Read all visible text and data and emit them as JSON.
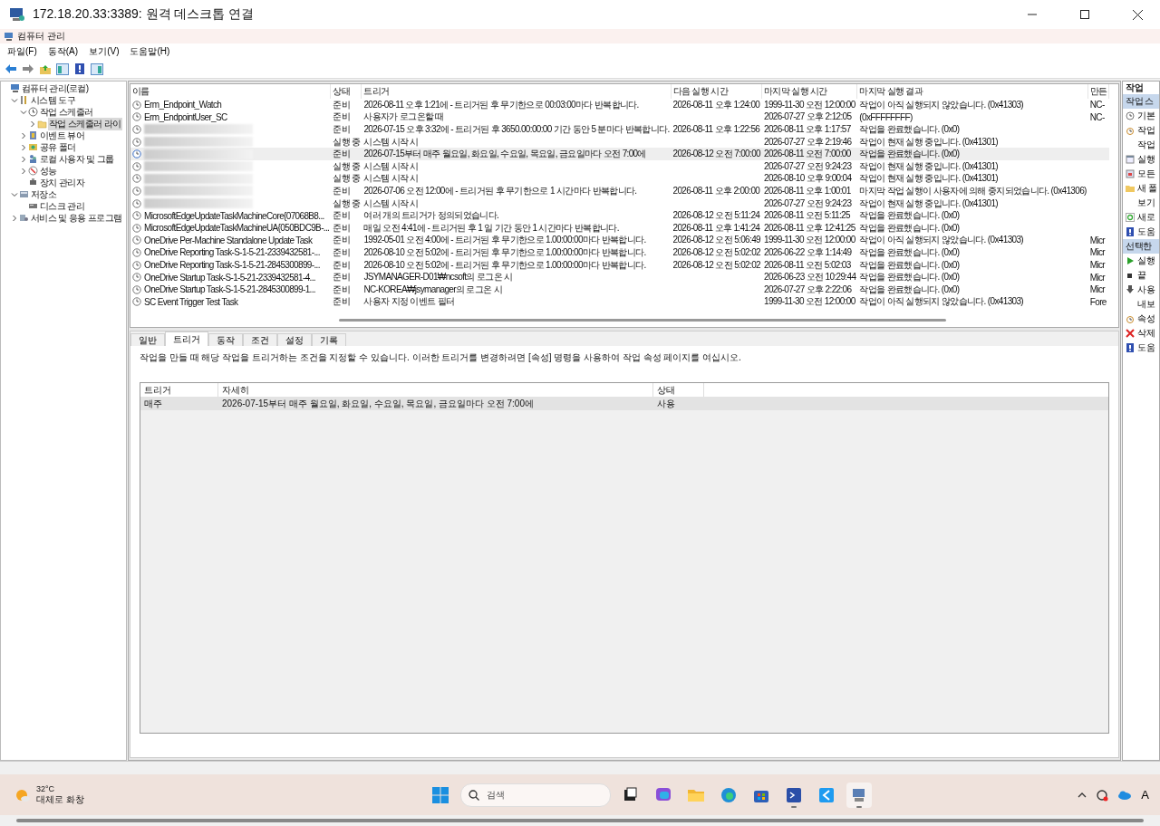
{
  "window": {
    "title": "172.18.20.33:3389: 원격 데스크톱 연결"
  },
  "app": {
    "title": "컴퓨터 관리"
  },
  "menu": [
    "파일(F)",
    "동작(A)",
    "보기(V)",
    "도움말(H)"
  ],
  "tree": [
    {
      "label": "컴퓨터 관리(로컬)",
      "selected": false,
      "children": [
        {
          "label": "시스템 도구",
          "expanded": true,
          "selected": false,
          "children": [
            {
              "label": "작업 스케줄러",
              "expanded": true,
              "selected": false,
              "children": [
                {
                  "label": "작업 스케줄러 라이",
                  "expanded": false,
                  "selected": true
                }
              ]
            },
            {
              "label": "이벤트 뷰어",
              "expanded": false,
              "selected": false
            },
            {
              "label": "공유 폴더",
              "expanded": false,
              "selected": false
            },
            {
              "label": "로컬 사용자 및 그룹",
              "expanded": false,
              "selected": false
            },
            {
              "label": "성능",
              "expanded": false,
              "selected": false
            },
            {
              "label": "장치 관리자",
              "selected": false
            }
          ]
        },
        {
          "label": "저장소",
          "expanded": true,
          "selected": false,
          "children": [
            {
              "label": "디스크 관리",
              "selected": false
            }
          ]
        },
        {
          "label": "서비스 및 응용 프로그램",
          "expanded": false,
          "selected": false
        }
      ]
    }
  ],
  "tasks": {
    "columns": [
      "이름",
      "상태",
      "트리거",
      "다음 실행 시간",
      "마지막 실행 시간",
      "마지막 실행 결과",
      "만든"
    ],
    "rows": [
      {
        "name": "Erm_Endpoint_Watch",
        "status": "준비",
        "trigger": "2026-08-11 오후 1:21에 - 트리거된 후 무기한으로 00:03:00마다 반복합니다.",
        "next_run": "2026-08-11 오후 1:24:00",
        "last_run": "1999-11-30 오전 12:00:00",
        "result": "작업이 아직 실행되지 않았습니다. (0x41303)",
        "creator": "NC-",
        "selected": false
      },
      {
        "name": "Erm_EndpointUser_SC",
        "status": "준비",
        "trigger": "사용자가 로그온할 때",
        "last_run": "2026-07-27 오후 2:12:05",
        "result": "(0xFFFFFFFF)",
        "creator": "NC-",
        "selected": false
      },
      {
        "redacted": true,
        "status": "준비",
        "trigger": "2026-07-15 오후 3:32에 - 트리거된 후 3650.00:00:00 기간 동안 5 분마다 반복합니다.",
        "next_run": "2026-08-11 오후 1:22:56",
        "last_run": "2026-08-11 오후 1:17:57",
        "result": "작업을 완료했습니다. (0x0)",
        "selected": false
      },
      {
        "redacted": true,
        "status": "실행 중",
        "trigger": "시스템 시작 시",
        "last_run": "2026-07-27 오후 2:19:46",
        "result": "작업이 현재 실행 중입니다. (0x41301)",
        "selected": false
      },
      {
        "redacted": true,
        "status": "준비",
        "trigger": "2026-07-15부터 매주 월요일, 화요일, 수요일, 목요일, 금요일마다 오전 7:00에",
        "next_run": "2026-08-12 오전 7:00:00",
        "last_run": "2026-08-11 오전 7:00:00",
        "result": "작업을 완료했습니다. (0x0)",
        "selected": true
      },
      {
        "redacted": true,
        "status": "실행 중",
        "trigger": "시스템 시작 시",
        "last_run": "2026-07-27 오전 9:24:23",
        "result": "작업이 현재 실행 중입니다. (0x41301)",
        "selected": false
      },
      {
        "redacted": true,
        "status": "실행 중",
        "trigger": "시스템 시작 시",
        "last_run": "2026-08-10 오후 9:00:04",
        "result": "작업이 현재 실행 중입니다. (0x41301)",
        "selected": false
      },
      {
        "redacted": true,
        "status": "준비",
        "trigger": "2026-07-06 오전 12:00에 - 트리거된 후 무기한으로 1 시간마다 반복합니다.",
        "next_run": "2026-08-11 오후 2:00:00",
        "last_run": "2026-08-11 오후 1:00:01",
        "result": "마지막 작업 실행이 사용자에 의해 중지되었습니다. (0x41306)",
        "selected": false
      },
      {
        "redacted": true,
        "status": "실행 중",
        "trigger": "시스템 시작 시",
        "last_run": "2026-07-27 오전 9:24:23",
        "result": "작업이 현재 실행 중입니다. (0x41301)",
        "selected": false
      },
      {
        "name": "MicrosoftEdgeUpdateTaskMachineCore{07068B8...",
        "status": "준비",
        "trigger": "여러 개의 트리거가 정의되었습니다.",
        "next_run": "2026-08-12 오전 5:11:24",
        "last_run": "2026-08-11 오전 5:11:25",
        "result": "작업을 완료했습니다. (0x0)",
        "selected": false
      },
      {
        "name": "MicrosoftEdgeUpdateTaskMachineUA{050BDC9B-...",
        "status": "준비",
        "trigger": "매일 오전 4:41에 - 트리거된 후 1 일 기간 동안 1 시간마다 반복합니다.",
        "next_run": "2026-08-11 오후 1:41:24",
        "last_run": "2026-08-11 오후 12:41:25",
        "result": "작업을 완료했습니다. (0x0)",
        "selected": false
      },
      {
        "name": "OneDrive Per-Machine Standalone Update Task",
        "status": "준비",
        "trigger": "1992-05-01 오전 4:00에 - 트리거된 후 무기한으로 1.00:00:00마다 반복합니다.",
        "next_run": "2026-08-12 오전 5:06:49",
        "last_run": "1999-11-30 오전 12:00:00",
        "result": "작업이 아직 실행되지 않았습니다. (0x41303)",
        "creator": "Micr",
        "selected": false
      },
      {
        "name": "OneDrive Reporting Task-S-1-5-21-2339432581-...",
        "status": "준비",
        "trigger": "2026-08-10 오전 5:02에 - 트리거된 후 무기한으로 1.00:00:00마다 반복합니다.",
        "next_run": "2026-08-12 오전 5:02:02",
        "last_run": "2026-06-22 오후 1:14:49",
        "result": "작업을 완료했습니다. (0x0)",
        "creator": "Micr",
        "selected": false
      },
      {
        "name": "OneDrive Reporting Task-S-1-5-21-2845300899-...",
        "status": "준비",
        "trigger": "2026-08-10 오전 5:02에 - 트리거된 후 무기한으로 1.00:00:00마다 반복합니다.",
        "next_run": "2026-08-12 오전 5:02:02",
        "last_run": "2026-08-11 오전 5:02:03",
        "result": "작업을 완료했습니다. (0x0)",
        "creator": "Micr",
        "selected": false
      },
      {
        "name": "OneDrive Startup Task-S-1-5-21-2339432581-4...",
        "status": "준비",
        "trigger": "JSYMANAGER-D01₩ncsoft의 로그온 시",
        "last_run": "2026-06-23 오전 10:29:44",
        "result": "작업을 완료했습니다. (0x0)",
        "creator": "Micr",
        "selected": false
      },
      {
        "name": "OneDrive Startup Task-S-1-5-21-2845300899-1...",
        "status": "준비",
        "trigger": "NC-KOREA₩jsymanager의 로그온 시",
        "last_run": "2026-07-27 오후 2:22:06",
        "result": "작업을 완료했습니다. (0x0)",
        "creator": "Micr",
        "selected": false
      },
      {
        "name": "SC Event Trigger Test Task",
        "status": "준비",
        "trigger": "사용자 지정 이벤트 필터",
        "last_run": "1999-11-30 오전 12:00:00",
        "result": "작업이 아직 실행되지 않았습니다. (0x41303)",
        "creator": "Fore",
        "selected": false
      }
    ]
  },
  "detail": {
    "tabs": [
      {
        "label": "일반",
        "selected": false
      },
      {
        "label": "트리거",
        "selected": true
      },
      {
        "label": "동작",
        "selected": false
      },
      {
        "label": "조건",
        "selected": false
      },
      {
        "label": "설정",
        "selected": false
      },
      {
        "label": "기록",
        "selected": false
      }
    ],
    "description": "작업을 만들 때 해당 작업을 트리거하는 조건을 지정할 수 있습니다. 이러한 트리거를 변경하려면 [속성] 명령을 사용하여 작업 속성 페이지를 여십시오.",
    "triggers": {
      "columns": [
        "트리거",
        "자세히",
        "상태"
      ],
      "rows": [
        {
          "trigger": "매주",
          "details": "2026-07-15부터 매주 월요일, 화요일, 수요일, 목요일, 금요일마다 오전 7:00에",
          "status": "사용",
          "selected": true
        }
      ]
    }
  },
  "actions": {
    "header": "작업",
    "sections": [
      {
        "title": "작업 스",
        "items": [
          "기본",
          "작업",
          "작업",
          "실행",
          "모든",
          "새 폴",
          "보기",
          "새로",
          "도움"
        ]
      },
      {
        "title": "선택한",
        "items": [
          "실행",
          "끝",
          "사용",
          "내보",
          "속성",
          "삭제",
          "도움"
        ]
      }
    ]
  },
  "taskbar": {
    "weather": {
      "temp": "32°C",
      "description": "대체로 화창"
    },
    "search": {
      "placeholder": "검색"
    },
    "apps": [
      {
        "kind": "taskview",
        "running": false
      },
      {
        "kind": "m365",
        "running": false
      },
      {
        "kind": "explorer",
        "running": false
      },
      {
        "kind": "edge",
        "running": false
      },
      {
        "kind": "store",
        "running": false
      },
      {
        "kind": "terminal",
        "running": true
      },
      {
        "kind": "vscode",
        "running": false
      },
      {
        "kind": "remote",
        "running": true
      }
    ],
    "tray": [
      {
        "kind": "chevron"
      },
      {
        "kind": "sync"
      },
      {
        "kind": "cloud"
      },
      {
        "kind": "ime",
        "text": "A"
      }
    ]
  }
}
